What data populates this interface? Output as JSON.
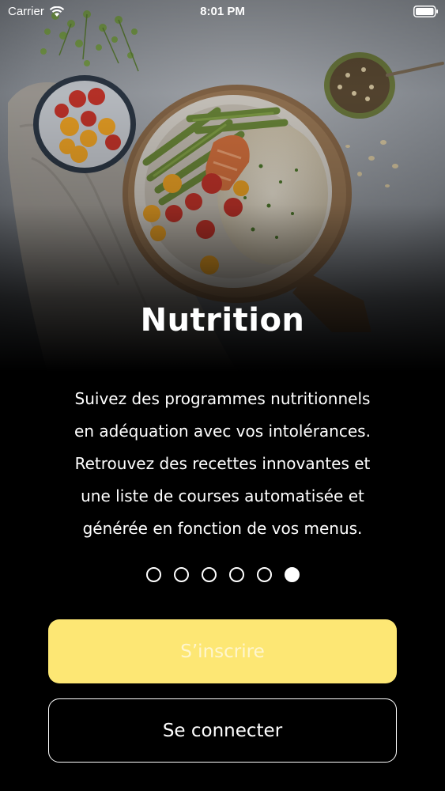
{
  "status_bar": {
    "carrier": "Carrier",
    "time": "8:01 PM"
  },
  "onboarding": {
    "title": "Nutrition",
    "description": "Suivez des programmes nutritionnels\nen adéquation avec vos intolérances.\nRetrouvez des recettes innovantes et\nune liste de courses automatisée et\ngénérée en fonction de vos menus.",
    "page_count": 6,
    "current_page": 6
  },
  "buttons": {
    "signup_label": "S’inscrire",
    "login_label": "Se connecter"
  },
  "colors": {
    "accent_yellow": "#fde774",
    "signup_text": "#fef6cf",
    "background": "#000000"
  },
  "icons": [
    "wifi-icon",
    "battery-icon"
  ]
}
